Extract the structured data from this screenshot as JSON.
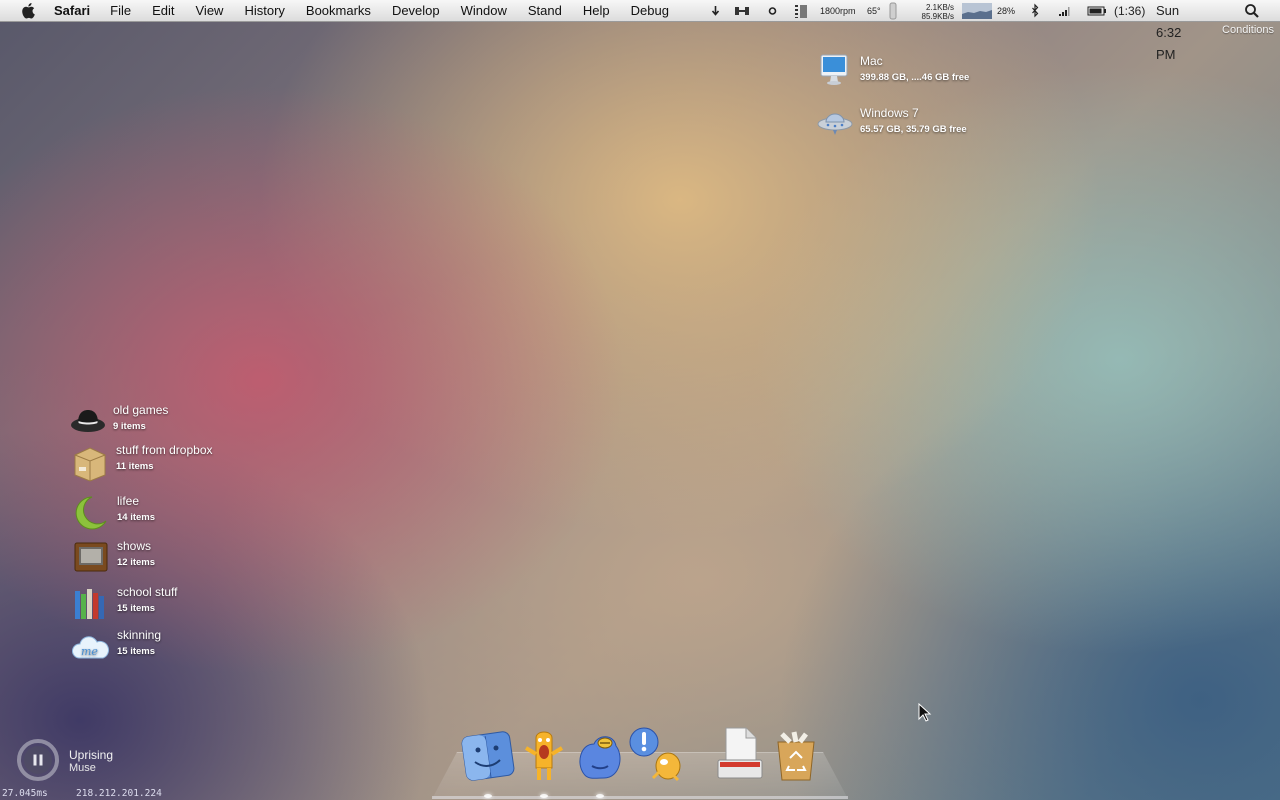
{
  "menubar": {
    "app": "Safari",
    "menus": [
      "File",
      "Edit",
      "View",
      "History",
      "Bookmarks",
      "Develop",
      "Window",
      "Stand",
      "Help",
      "Debug"
    ],
    "fan_speed": "1800rpm",
    "temperature": "65°",
    "net_up": "2.1KB/s",
    "net_down": "85.9KB/s",
    "cpu": "28%",
    "battery_time": "(1:36)",
    "clock": "Sun 6:32 PM"
  },
  "conditions": "Conditions",
  "drives": [
    {
      "name": "Mac",
      "info": "399.88 GB, ....46 GB free",
      "icon": "imac-icon"
    },
    {
      "name": "Windows 7",
      "info": "65.57 GB, 35.79 GB free",
      "icon": "ufo-drive-icon"
    }
  ],
  "stacks": [
    {
      "name": "old games",
      "count": "9 items",
      "icon": "hat-icon"
    },
    {
      "name": "stuff from dropbox",
      "count": "11 items",
      "icon": "box-icon"
    },
    {
      "name": "lifee",
      "count": "14 items",
      "icon": "moon-icon"
    },
    {
      "name": "shows",
      "count": "12 items",
      "icon": "tv-icon"
    },
    {
      "name": "school stuff",
      "count": "15 items",
      "icon": "books-icon"
    },
    {
      "name": "skinning",
      "count": "15 items",
      "icon": "cloud-icon"
    }
  ],
  "now_playing": {
    "title": "Uprising",
    "artist": "Muse"
  },
  "status": {
    "ping": "27.045ms",
    "ip": "218.212.201.224"
  },
  "dock": [
    "finder-icon",
    "adium-icon",
    "skype-icon",
    "growl-icon",
    "documents-icon",
    "trash-icon"
  ],
  "colors": {
    "desktop_accent": "#d8b27e",
    "menubar": "#e8e8e8"
  }
}
